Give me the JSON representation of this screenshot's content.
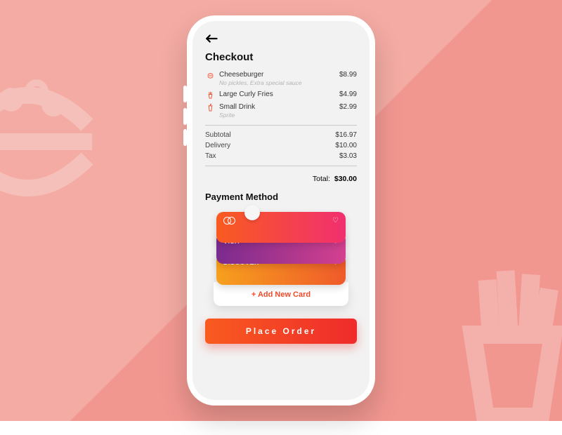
{
  "header": {
    "title": "Checkout"
  },
  "order": {
    "items": [
      {
        "name": "Cheeseburger",
        "note": "No pickles, Extra special sauce",
        "price": "$8.99",
        "icon": "burger"
      },
      {
        "name": "Large Curly Fries",
        "note": "",
        "price": "$4.99",
        "icon": "fries"
      },
      {
        "name": "Small Drink",
        "note": "Sprite",
        "price": "$2.99",
        "icon": "drink"
      }
    ],
    "subtotal_label": "Subtotal",
    "subtotal": "$16.97",
    "delivery_label": "Delivery",
    "delivery": "$10.00",
    "tax_label": "Tax",
    "tax": "$3.03",
    "total_label": "Total:",
    "total": "$30.00"
  },
  "payment": {
    "section_title": "Payment Method",
    "cards": [
      {
        "brand": "mastercard",
        "brand_label": ""
      },
      {
        "brand": "visa",
        "brand_label": "VISA"
      },
      {
        "brand": "discover",
        "brand_label": "DISCOVER"
      }
    ],
    "add_label": "+ Add New Card"
  },
  "cta": {
    "place_order": "Place Order"
  }
}
